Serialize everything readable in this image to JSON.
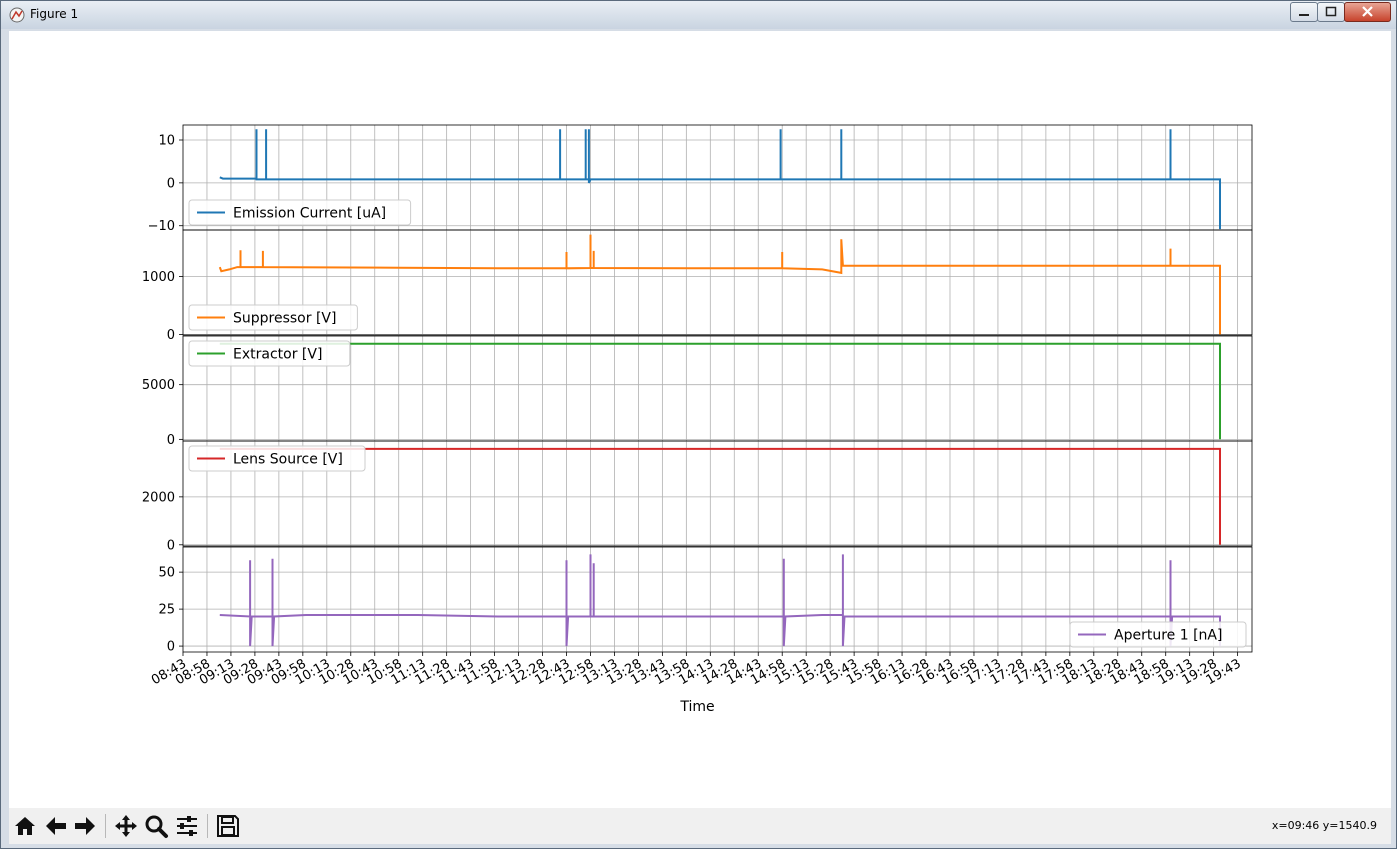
{
  "window": {
    "title": "Figure 1"
  },
  "toolbar": {
    "buttons": [
      {
        "name": "home-icon"
      },
      {
        "name": "back-arrow-icon"
      },
      {
        "name": "forward-arrow-icon"
      },
      {
        "name": "pan-icon"
      },
      {
        "name": "zoom-icon"
      },
      {
        "name": "subplots-config-icon"
      },
      {
        "name": "save-icon"
      }
    ],
    "coords": "x=09:46 y=1540.9"
  },
  "chart_data": {
    "type": "line",
    "xlabel": "Time",
    "x_ticks": [
      "08:43",
      "08:58",
      "09:13",
      "09:28",
      "09:43",
      "09:58",
      "10:13",
      "10:28",
      "10:43",
      "10:58",
      "11:13",
      "11:28",
      "11:43",
      "11:58",
      "12:13",
      "12:28",
      "12:43",
      "12:58",
      "13:13",
      "13:28",
      "13:43",
      "13:58",
      "14:13",
      "14:28",
      "14:43",
      "14:58",
      "15:13",
      "15:28",
      "15:43",
      "15:58",
      "16:13",
      "16:28",
      "16:43",
      "16:58",
      "17:13",
      "17:28",
      "17:43",
      "17:58",
      "18:13",
      "18:28",
      "18:43",
      "18:58",
      "19:13",
      "19:28",
      "19:43"
    ],
    "x_range": [
      "08:43",
      "19:52"
    ],
    "grid": true,
    "panels": [
      {
        "series": "Emission Current [uA]",
        "color": "#1f77b4",
        "legend": "lower-left",
        "yticks": [
          10,
          0,
          -10
        ],
        "ylim": [
          -11,
          13.5
        ],
        "points": [
          [
            "09:06",
            1.3
          ],
          [
            "09:08",
            1.0
          ],
          [
            "09:29",
            1.0
          ],
          [
            "09:29",
            12.5
          ],
          [
            "09:29",
            0.8
          ],
          [
            "09:35",
            0.8
          ],
          [
            "09:35",
            12.5
          ],
          [
            "09:35",
            0.8
          ],
          [
            "12:39",
            0.8
          ],
          [
            "12:39",
            12.5
          ],
          [
            "12:39",
            0.8
          ],
          [
            "12:55",
            0.8
          ],
          [
            "12:55",
            12.5
          ],
          [
            "12:55",
            0.8
          ],
          [
            "12:57",
            0.8
          ],
          [
            "12:57",
            12.5
          ],
          [
            "12:57",
            0.0
          ],
          [
            "12:58",
            0.8
          ],
          [
            "14:57",
            0.8
          ],
          [
            "14:57",
            12.5
          ],
          [
            "14:57",
            0.8
          ],
          [
            "15:35",
            0.8
          ],
          [
            "15:35",
            12.5
          ],
          [
            "15:35",
            0.8
          ],
          [
            "19:01",
            0.8
          ],
          [
            "19:01",
            12.5
          ],
          [
            "19:01",
            0.8
          ],
          [
            "19:32",
            0.8
          ],
          [
            "19:32",
            -10.8
          ]
        ]
      },
      {
        "series": "Suppressor [V]",
        "color": "#ff7f0e",
        "legend": "lower-left",
        "yticks": [
          1000,
          0
        ],
        "ylim": [
          -10,
          1800
        ],
        "points": [
          [
            "09:06",
            1160
          ],
          [
            "09:07",
            1090
          ],
          [
            "09:12",
            1120
          ],
          [
            "09:17",
            1160
          ],
          [
            "09:19",
            1160
          ],
          [
            "09:19",
            1450
          ],
          [
            "09:19",
            1160
          ],
          [
            "09:33",
            1160
          ],
          [
            "09:33",
            1440
          ],
          [
            "09:33",
            1160
          ],
          [
            "10:58",
            1150
          ],
          [
            "12:00",
            1140
          ],
          [
            "12:43",
            1140
          ],
          [
            "12:43",
            1420
          ],
          [
            "12:43",
            1140
          ],
          [
            "12:58",
            1145
          ],
          [
            "12:58",
            1720
          ],
          [
            "12:58",
            1145
          ],
          [
            "13:00",
            1145
          ],
          [
            "13:00",
            1440
          ],
          [
            "13:00",
            1145
          ],
          [
            "14:00",
            1140
          ],
          [
            "14:58",
            1140
          ],
          [
            "14:58",
            1420
          ],
          [
            "14:58",
            1140
          ],
          [
            "15:23",
            1120
          ],
          [
            "15:35",
            1060
          ],
          [
            "15:35",
            1640
          ],
          [
            "15:36",
            1185
          ],
          [
            "17:00",
            1185
          ],
          [
            "19:01",
            1185
          ],
          [
            "19:01",
            1480
          ],
          [
            "19:01",
            1185
          ],
          [
            "19:32",
            1185
          ],
          [
            "19:32",
            0
          ]
        ]
      },
      {
        "series": "Extractor [V]",
        "color": "#2ca02c",
        "legend": "upper-left",
        "yticks": [
          5000,
          0
        ],
        "ylim": [
          -150,
          9450
        ],
        "points": [
          [
            "09:06",
            8750
          ],
          [
            "19:32",
            8750
          ],
          [
            "19:32",
            0
          ]
        ]
      },
      {
        "series": "Lens Source [V]",
        "color": "#d62728",
        "legend": "upper-left",
        "yticks": [
          2000,
          0
        ],
        "ylim": [
          -50,
          4330
        ],
        "points": [
          [
            "09:06",
            4000
          ],
          [
            "19:32",
            4000
          ],
          [
            "19:32",
            0
          ]
        ]
      },
      {
        "series": "Aperture 1 [nA]",
        "color": "#9467bd",
        "legend": "lower-right",
        "yticks": [
          50,
          25,
          0
        ],
        "ylim": [
          -4,
          67
        ],
        "points": [
          [
            "09:06",
            21
          ],
          [
            "09:25",
            20
          ],
          [
            "09:25",
            58
          ],
          [
            "09:25",
            0
          ],
          [
            "09:26",
            20
          ],
          [
            "09:39",
            20
          ],
          [
            "09:39",
            59
          ],
          [
            "09:39",
            0
          ],
          [
            "09:40",
            20
          ],
          [
            "10:00",
            21
          ],
          [
            "11:10",
            21
          ],
          [
            "12:00",
            20
          ],
          [
            "12:43",
            20
          ],
          [
            "12:43",
            58
          ],
          [
            "12:43",
            0
          ],
          [
            "12:44",
            20
          ],
          [
            "12:58",
            20
          ],
          [
            "12:58",
            62
          ],
          [
            "12:58",
            20
          ],
          [
            "13:00",
            20
          ],
          [
            "13:00",
            56
          ],
          [
            "13:00",
            20
          ],
          [
            "14:00",
            20
          ],
          [
            "14:59",
            20
          ],
          [
            "14:59",
            59
          ],
          [
            "14:59",
            0
          ],
          [
            "15:00",
            20
          ],
          [
            "15:23",
            21
          ],
          [
            "15:36",
            21
          ],
          [
            "15:36",
            62
          ],
          [
            "15:36",
            0
          ],
          [
            "15:37",
            20
          ],
          [
            "17:00",
            20
          ],
          [
            "19:01",
            20
          ],
          [
            "19:01",
            58
          ],
          [
            "19:01",
            0
          ],
          [
            "19:02",
            20
          ],
          [
            "19:32",
            20
          ],
          [
            "19:32",
            0
          ]
        ]
      }
    ]
  }
}
